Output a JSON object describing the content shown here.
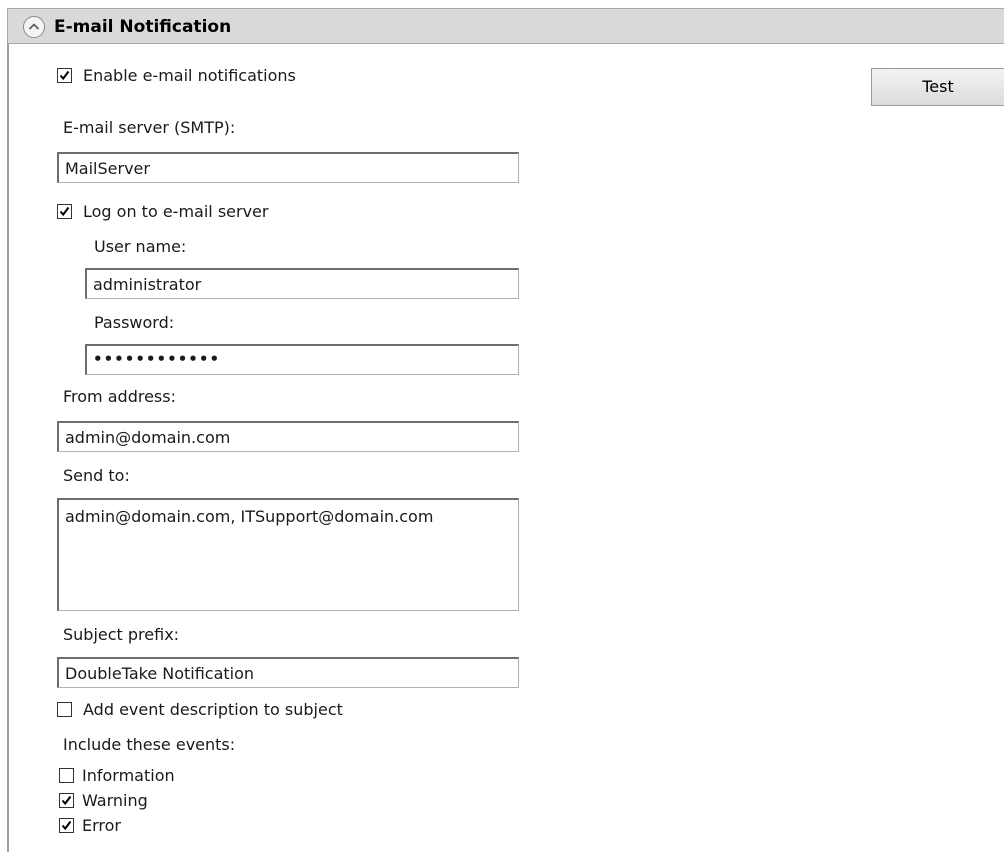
{
  "section": {
    "title": "E-mail Notification"
  },
  "enable": {
    "label": "Enable e-mail notifications",
    "checked": true
  },
  "test_button": {
    "label": "Test"
  },
  "smtp": {
    "label": "E-mail server (SMTP):",
    "value": "MailServer"
  },
  "logon": {
    "label": "Log on to e-mail server",
    "checked": true
  },
  "username": {
    "label": "User name:",
    "value": "administrator"
  },
  "password": {
    "label": "Password:",
    "masked_value": "••••••••••••"
  },
  "from": {
    "label": "From address:",
    "value": "admin@domain.com"
  },
  "send_to": {
    "label": "Send to:",
    "value": "admin@domain.com, ITSupport@domain.com"
  },
  "subject": {
    "label": "Subject prefix:",
    "value": "DoubleTake Notification"
  },
  "add_event": {
    "label": "Add event description to subject",
    "checked": false
  },
  "events": {
    "label": "Include these events:",
    "items": [
      {
        "label": "Information",
        "checked": false
      },
      {
        "label": "Warning",
        "checked": true
      },
      {
        "label": "Error",
        "checked": true
      }
    ]
  },
  "icons": {
    "collapse": "chevron-up-icon",
    "check": "checkmark-icon"
  }
}
